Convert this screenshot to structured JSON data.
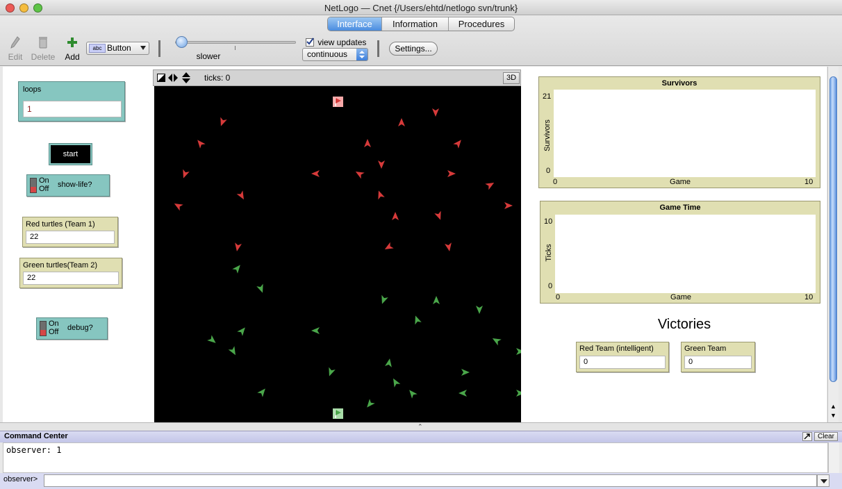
{
  "window": {
    "title": "NetLogo — Cnet {/Users/ehtd/netlogo svn/trunk}"
  },
  "tabs": [
    {
      "label": "Interface",
      "active": true
    },
    {
      "label": "Information",
      "active": false
    },
    {
      "label": "Procedures",
      "active": false
    }
  ],
  "toolbar": {
    "edit_label": "Edit",
    "delete_label": "Delete",
    "add_label": "Add",
    "widget_type": "Button",
    "speed_label": "slower",
    "speed_value": 0.02,
    "view_updates_label": "view updates",
    "view_updates_checked": true,
    "update_mode": "continuous",
    "settings_label": "Settings..."
  },
  "widgets": {
    "loops": {
      "label": "loops",
      "value": "1"
    },
    "start": {
      "label": "start"
    },
    "show_life": {
      "on": "On",
      "off": "Off",
      "label": "show-life?"
    },
    "red_turtles": {
      "label": "Red turtles (Team 1)",
      "value": "22"
    },
    "green_turtles": {
      "label": "Green turtles(Team 2)",
      "value": "22"
    },
    "debug": {
      "on": "On",
      "off": "Off",
      "label": "debug?"
    },
    "victories_title": "Victories",
    "red_team": {
      "label": "Red Team (intelligent)",
      "value": "0"
    },
    "green_team": {
      "label": "Green Team",
      "value": "0"
    }
  },
  "view": {
    "ticks_label": "ticks: 0",
    "three_d_label": "3D",
    "background": "#000000",
    "red_color": "#d63a3a",
    "green_color": "#4aa64a"
  },
  "plots": {
    "survivors": {
      "title": "Survivors",
      "ylabel": "Survivors",
      "xlabel": "Game",
      "xmin": "0",
      "xmax": "10",
      "ymin": "0",
      "ymax": "21"
    },
    "game_time": {
      "title": "Game Time",
      "ylabel": "Ticks",
      "xlabel": "Game",
      "xmin": "0",
      "xmax": "10",
      "ymin": "0",
      "ymax": "10"
    }
  },
  "command_center": {
    "title": "Command Center",
    "clear_label": "Clear",
    "output": "observer: 1",
    "prompt": "observer>"
  }
}
